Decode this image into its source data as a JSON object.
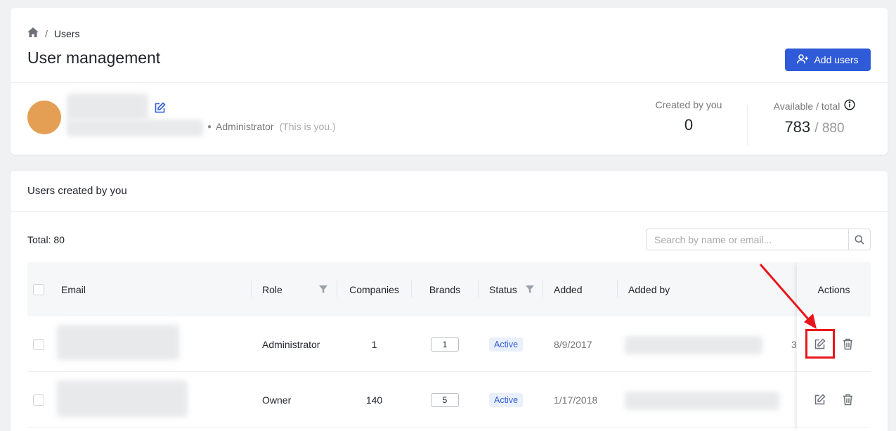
{
  "breadcrumb": {
    "current": "Users"
  },
  "header": {
    "title": "User management",
    "add_button": "Add users"
  },
  "profile": {
    "role": "Administrator",
    "note": "(This is you.)"
  },
  "stats": {
    "created_label": "Created by you",
    "created_value": "0",
    "available_label": "Available / total",
    "available_value": "783",
    "total_value": "/ 880"
  },
  "section": {
    "title": "Users created by you"
  },
  "toolbar": {
    "total_label": "Total: 80",
    "search_placeholder": "Search by name or email..."
  },
  "table": {
    "columns": {
      "email": "Email",
      "role": "Role",
      "companies": "Companies",
      "brands": "Brands",
      "status": "Status",
      "added": "Added",
      "added_by": "Added by",
      "actions": "Actions"
    },
    "rows": [
      {
        "role": "Administrator",
        "companies": "1",
        "brands": "1",
        "status": "Active",
        "added": "8/9/2017",
        "overflow": "3"
      },
      {
        "role": "Owner",
        "companies": "140",
        "brands": "5",
        "status": "Active",
        "added": "1/17/2018"
      }
    ]
  },
  "colors": {
    "primary": "#2f5bd8",
    "avatar": "#e49f55",
    "highlight": "#e8161b"
  }
}
